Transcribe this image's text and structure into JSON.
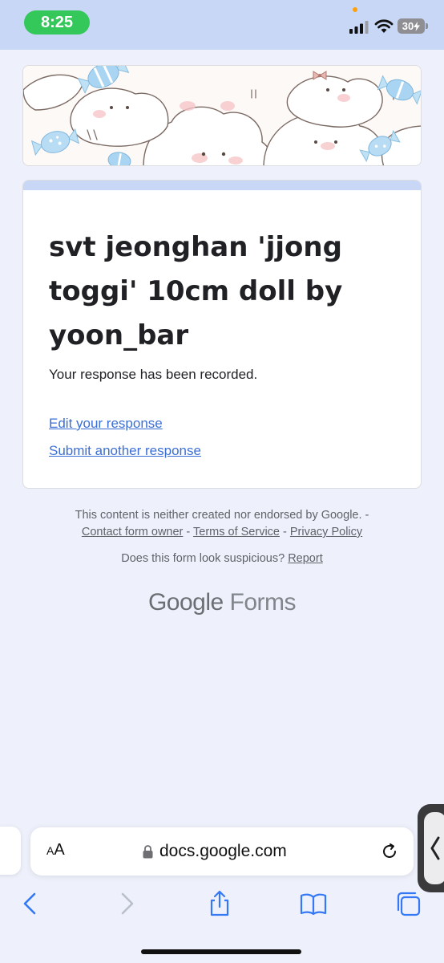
{
  "status_bar": {
    "time": "8:25",
    "battery_level": "30",
    "icons": [
      "signal-icon",
      "wifi-icon",
      "battery-icon"
    ]
  },
  "form": {
    "title": "svt jeonghan 'jjong toggi' 10cm doll by yoon_bar",
    "confirmation": "Your response has been recorded.",
    "edit_link": "Edit your response",
    "another_link": "Submit another response"
  },
  "footer": {
    "disclaimer": "This content is neither created nor endorsed by Google. -",
    "contact_owner": "Contact form owner",
    "terms": "Terms of Service",
    "privacy": "Privacy Policy",
    "separator": " - ",
    "suspicious_text": "Does this form look suspicious?",
    "report": "Report",
    "logo_google": "Google",
    "logo_forms": "Forms"
  },
  "browser": {
    "text_size_button_small": "A",
    "text_size_button_large": "A",
    "url": "docs.google.com",
    "toolbar": [
      "back-icon",
      "forward-icon",
      "share-icon",
      "bookmarks-icon",
      "tabs-icon"
    ]
  },
  "colors": {
    "accent": "#c9d7f6",
    "link": "#3c6fd6",
    "status_pill": "#34c759",
    "page_background": "#eef1fb"
  }
}
